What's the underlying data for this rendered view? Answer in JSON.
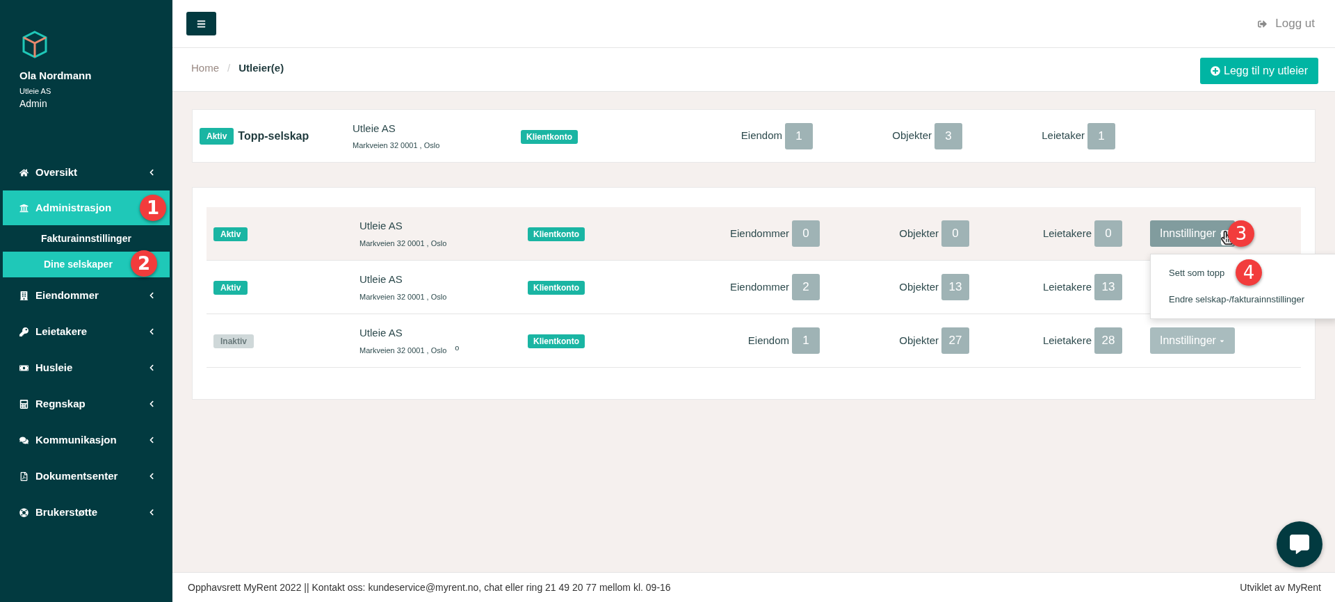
{
  "sidebar": {
    "user": {
      "name": "Ola Nordmann",
      "company": "Utleie AS",
      "role": "Admin"
    },
    "items": [
      {
        "label": "Oversikt",
        "selected": false,
        "expandable": true
      },
      {
        "label": "Administrasjon",
        "selected": true,
        "expandable": false,
        "callout": "1",
        "children": [
          {
            "label": "Fakturainnstillinger",
            "selected": false
          },
          {
            "label": "Dine selskaper",
            "selected": true,
            "callout": "2"
          }
        ]
      },
      {
        "label": "Eiendommer",
        "selected": false,
        "expandable": true
      },
      {
        "label": "Leietakere",
        "selected": false,
        "expandable": true
      },
      {
        "label": "Husleie",
        "selected": false,
        "expandable": true
      },
      {
        "label": "Regnskap",
        "selected": false,
        "expandable": true
      },
      {
        "label": "Kommunikasjon",
        "selected": false,
        "expandable": true
      },
      {
        "label": "Dokumentsenter",
        "selected": false,
        "expandable": true
      },
      {
        "label": "Brukerstøtte",
        "selected": false,
        "expandable": true
      }
    ]
  },
  "topbar": {
    "logout": "Logg ut"
  },
  "breadcrumb": {
    "items": [
      "Home",
      "Utleier(e)"
    ],
    "separator": "/"
  },
  "add_button": "Legg til ny utleier",
  "top_company": {
    "status": "Aktiv",
    "active": true,
    "title": "Topp-selskap",
    "name": "Utleie AS",
    "address": "Markveien 32 0001 , Oslo",
    "account": "Klientkonto",
    "stats": [
      {
        "label": "Eiendom",
        "value": "1"
      },
      {
        "label": "Objekter",
        "value": "3"
      },
      {
        "label": "Leietaker",
        "value": "1"
      }
    ]
  },
  "companies": [
    {
      "status": "Aktiv",
      "active": true,
      "highlighted": true,
      "name": "Utleie AS",
      "address": "Markveien 32 0001 , Oslo",
      "account": "Klientkonto",
      "stats": [
        {
          "label": "Eiendommer",
          "value": "0"
        },
        {
          "label": "Objekter",
          "value": "0"
        },
        {
          "label": "Leietakere",
          "value": "0"
        }
      ],
      "settings": {
        "label": "Innstillinger",
        "open": true,
        "callout": "3",
        "menu": [
          {
            "label": "Sett som topp",
            "callout": "4"
          },
          {
            "label": "Endre selskap-/fakturainnstillinger"
          }
        ]
      }
    },
    {
      "status": "Aktiv",
      "active": true,
      "highlighted": false,
      "name": "Utleie AS",
      "address": "Markveien 32 0001 , Oslo",
      "account": "Klientkonto",
      "stats": [
        {
          "label": "Eiendommer",
          "value": "2"
        },
        {
          "label": "Objekter",
          "value": "13"
        },
        {
          "label": "Leietakere",
          "value": "13"
        }
      ]
    },
    {
      "status": "Inaktiv",
      "active": false,
      "highlighted": false,
      "name": "Utleie AS",
      "address": "Markveien 32 0001 , Oslo",
      "fragment": "o",
      "account": "Klientkonto",
      "stats": [
        {
          "label": "Eiendom",
          "value": "1"
        },
        {
          "label": "Objekter",
          "value": "27"
        },
        {
          "label": "Leietakere",
          "value": "28"
        }
      ],
      "settings": {
        "label": "Innstillinger",
        "open": false
      }
    }
  ],
  "footer": {
    "text": "Opphavsrett MyRent 2022 || Kontakt oss: kundeservice@myrent.no, chat eller ring 21 49 20 77 mellom kl. 09-16",
    "credit": "Utviklet av MyRent"
  }
}
